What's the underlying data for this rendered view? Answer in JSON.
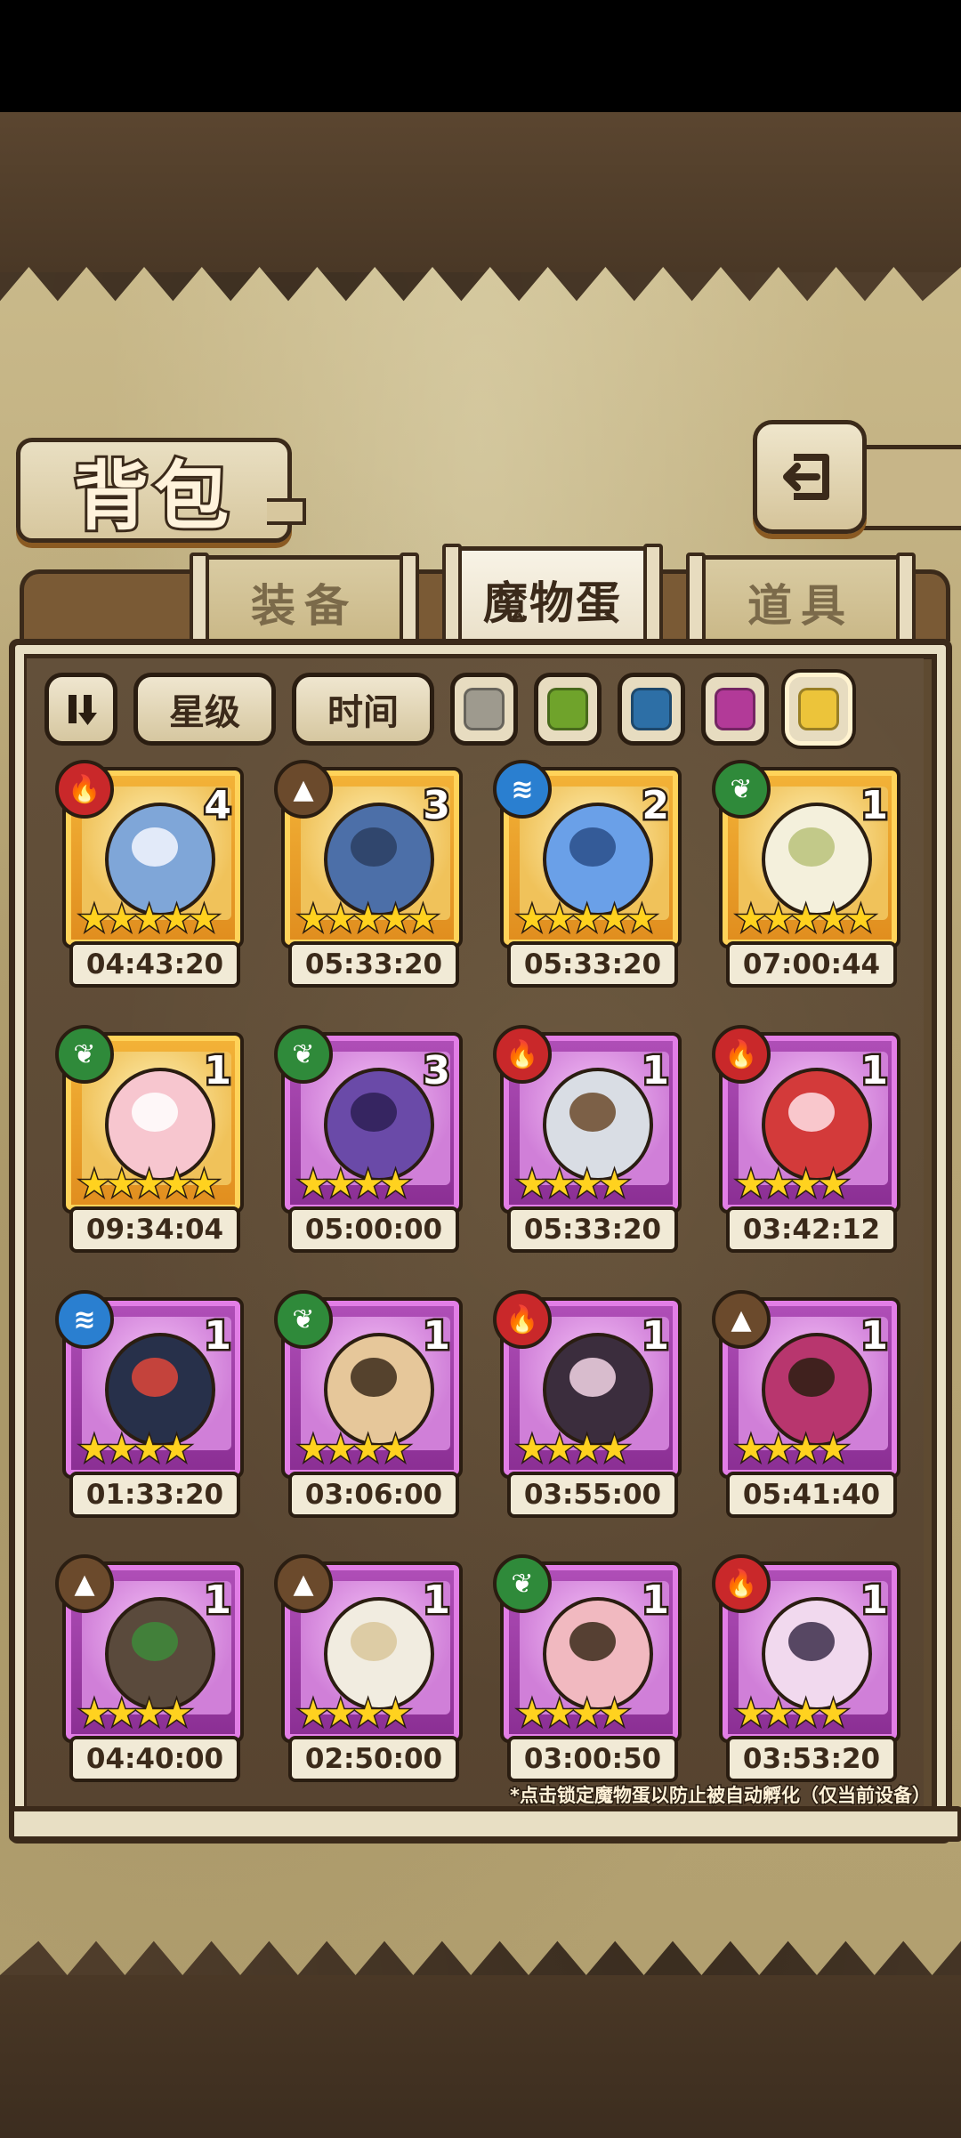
{
  "header": {
    "title": "背包"
  },
  "tabs": [
    {
      "label": "装备",
      "active": false
    },
    {
      "label": "魔物蛋",
      "active": true
    },
    {
      "label": "道具",
      "active": false
    }
  ],
  "filters": {
    "sort_toggle_icon": "pause-sort-icon",
    "star_label": "星级",
    "time_label": "时间",
    "colors": [
      "#9e9a8e",
      "#6fa32b",
      "#2d6fa6",
      "#b23a98",
      "#ecc43a"
    ],
    "selected_color_index": 4
  },
  "eggs": [
    {
      "count": "4",
      "stars": "★★★★★",
      "timer": "04:43:20",
      "element": "fire",
      "rarity": "gold"
    },
    {
      "count": "3",
      "stars": "★★★★★",
      "timer": "05:33:20",
      "element": "earth",
      "rarity": "gold"
    },
    {
      "count": "2",
      "stars": "★★★★★",
      "timer": "05:33:20",
      "element": "water",
      "rarity": "gold"
    },
    {
      "count": "1",
      "stars": "★★★★★",
      "timer": "07:00:44",
      "element": "wind",
      "rarity": "gold"
    },
    {
      "count": "1",
      "stars": "★★★★★",
      "timer": "09:34:04",
      "element": "wind",
      "rarity": "gold"
    },
    {
      "count": "3",
      "stars": "★★★★",
      "timer": "05:00:00",
      "element": "wind",
      "rarity": "purple"
    },
    {
      "count": "1",
      "stars": "★★★★",
      "timer": "05:33:20",
      "element": "fire",
      "rarity": "purple"
    },
    {
      "count": "1",
      "stars": "★★★★",
      "timer": "03:42:12",
      "element": "fire",
      "rarity": "purple"
    },
    {
      "count": "1",
      "stars": "★★★★",
      "timer": "01:33:20",
      "element": "water",
      "rarity": "purple"
    },
    {
      "count": "1",
      "stars": "★★★★",
      "timer": "03:06:00",
      "element": "wind",
      "rarity": "purple"
    },
    {
      "count": "1",
      "stars": "★★★★",
      "timer": "03:55:00",
      "element": "fire",
      "rarity": "purple"
    },
    {
      "count": "1",
      "stars": "★★★★",
      "timer": "05:41:40",
      "element": "earth",
      "rarity": "purple"
    },
    {
      "count": "1",
      "stars": "★★★★",
      "timer": "04:40:00",
      "element": "earth",
      "rarity": "purple"
    },
    {
      "count": "1",
      "stars": "★★★★",
      "timer": "02:50:00",
      "element": "earth",
      "rarity": "purple"
    },
    {
      "count": "1",
      "stars": "★★★★",
      "timer": "03:00:50",
      "element": "wind",
      "rarity": "purple"
    },
    {
      "count": "1",
      "stars": "★★★★",
      "timer": "03:53:20",
      "element": "fire",
      "rarity": "purple"
    }
  ],
  "footer_note": "*点击锁定魔物蛋以防止被自动孵化（仅当前设备）",
  "element_icons": {
    "fire": "🔥",
    "earth": "▲",
    "water": "≋",
    "wind": "❦"
  }
}
